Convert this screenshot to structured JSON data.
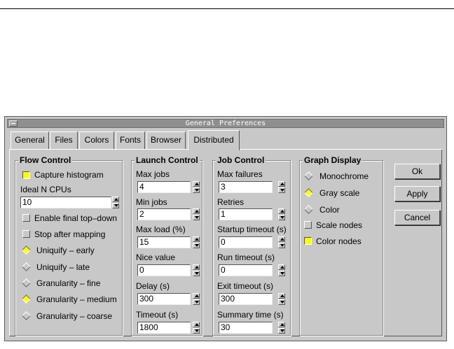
{
  "window": {
    "title": "General Preferences"
  },
  "tabs": [
    {
      "label": "General"
    },
    {
      "label": "Files"
    },
    {
      "label": "Colors"
    },
    {
      "label": "Fonts"
    },
    {
      "label": "Browser"
    },
    {
      "label": "Distributed",
      "active": true
    }
  ],
  "flow_control": {
    "title": "Flow Control",
    "capture_histogram": {
      "label": "Capture histogram",
      "checked": true
    },
    "ideal_cpus": {
      "label": "Ideal N CPUs",
      "value": "10"
    },
    "enable_final_top_down": {
      "label": "Enable final top–down",
      "checked": false
    },
    "stop_after_mapping": {
      "label": "Stop after mapping",
      "checked": false
    },
    "radios": [
      {
        "label": "Uniquify – early",
        "selected": true
      },
      {
        "label": "Uniquify – late",
        "selected": false
      },
      {
        "label": "Granularity – fine",
        "selected": false
      },
      {
        "label": "Granularity – medium",
        "selected": true
      },
      {
        "label": "Granularity – coarse",
        "selected": false
      }
    ]
  },
  "launch_control": {
    "title": "Launch Control",
    "fields": [
      {
        "label": "Max jobs",
        "value": "4"
      },
      {
        "label": "Min jobs",
        "value": "2"
      },
      {
        "label": "Max load (%)",
        "value": "15"
      },
      {
        "label": "Nice value",
        "value": "0"
      },
      {
        "label": "Delay (s)",
        "value": "300"
      },
      {
        "label": "Timeout (s)",
        "value": "1800"
      }
    ]
  },
  "job_control": {
    "title": "Job Control",
    "fields": [
      {
        "label": "Max failures",
        "value": "3"
      },
      {
        "label": "Retries",
        "value": "1"
      },
      {
        "label": "Startup timeout (s)",
        "value": "0"
      },
      {
        "label": "Run timeout (s)",
        "value": "0"
      },
      {
        "label": "Exit timeout (s)",
        "value": "300"
      },
      {
        "label": "Summary time (s)",
        "value": "30"
      }
    ]
  },
  "graph_display": {
    "title": "Graph Display",
    "radios": [
      {
        "label": "Monochrome",
        "selected": false
      },
      {
        "label": "Gray scale",
        "selected": true
      },
      {
        "label": "Color",
        "selected": false
      }
    ],
    "scale_nodes": {
      "label": "Scale nodes",
      "checked": false
    },
    "color_nodes": {
      "label": "Color nodes",
      "checked": true
    }
  },
  "buttons": {
    "ok": "Ok",
    "apply": "Apply",
    "cancel": "Cancel"
  },
  "colors": {
    "dialog_bg": "#c8c8c8",
    "title_bg": "#8f8f8f",
    "accent_yellow": "#ffff00"
  }
}
